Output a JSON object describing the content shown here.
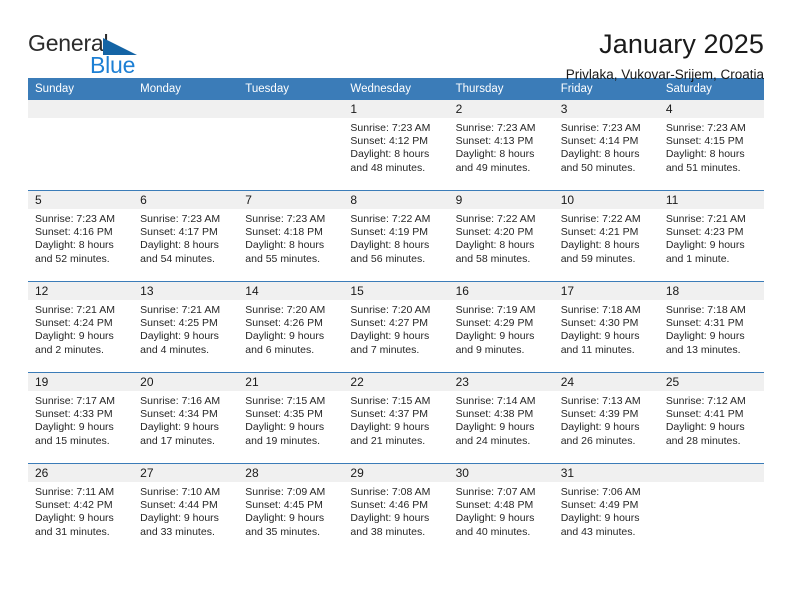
{
  "brand": {
    "name_top": "General",
    "name_bottom": "Blue",
    "triangle_color": "#1464a5",
    "blue_color": "#1c7fd4"
  },
  "header": {
    "title": "January 2025",
    "subtitle": "Privlaka, Vukovar-Srijem, Croatia"
  },
  "theme": {
    "header_blue": "#3b7cb8",
    "daynum_band": "#f0f0f0",
    "text": "#1a1a1a"
  },
  "weekday_headers": [
    "Sunday",
    "Monday",
    "Tuesday",
    "Wednesday",
    "Thursday",
    "Friday",
    "Saturday"
  ],
  "weeks": [
    [
      {
        "day": "",
        "empty": true
      },
      {
        "day": "",
        "empty": true
      },
      {
        "day": "",
        "empty": true
      },
      {
        "day": "1",
        "sunrise": "Sunrise: 7:23 AM",
        "sunset": "Sunset: 4:12 PM",
        "daylight1": "Daylight: 8 hours",
        "daylight2": "and 48 minutes."
      },
      {
        "day": "2",
        "sunrise": "Sunrise: 7:23 AM",
        "sunset": "Sunset: 4:13 PM",
        "daylight1": "Daylight: 8 hours",
        "daylight2": "and 49 minutes."
      },
      {
        "day": "3",
        "sunrise": "Sunrise: 7:23 AM",
        "sunset": "Sunset: 4:14 PM",
        "daylight1": "Daylight: 8 hours",
        "daylight2": "and 50 minutes."
      },
      {
        "day": "4",
        "sunrise": "Sunrise: 7:23 AM",
        "sunset": "Sunset: 4:15 PM",
        "daylight1": "Daylight: 8 hours",
        "daylight2": "and 51 minutes."
      }
    ],
    [
      {
        "day": "5",
        "sunrise": "Sunrise: 7:23 AM",
        "sunset": "Sunset: 4:16 PM",
        "daylight1": "Daylight: 8 hours",
        "daylight2": "and 52 minutes."
      },
      {
        "day": "6",
        "sunrise": "Sunrise: 7:23 AM",
        "sunset": "Sunset: 4:17 PM",
        "daylight1": "Daylight: 8 hours",
        "daylight2": "and 54 minutes."
      },
      {
        "day": "7",
        "sunrise": "Sunrise: 7:23 AM",
        "sunset": "Sunset: 4:18 PM",
        "daylight1": "Daylight: 8 hours",
        "daylight2": "and 55 minutes."
      },
      {
        "day": "8",
        "sunrise": "Sunrise: 7:22 AM",
        "sunset": "Sunset: 4:19 PM",
        "daylight1": "Daylight: 8 hours",
        "daylight2": "and 56 minutes."
      },
      {
        "day": "9",
        "sunrise": "Sunrise: 7:22 AM",
        "sunset": "Sunset: 4:20 PM",
        "daylight1": "Daylight: 8 hours",
        "daylight2": "and 58 minutes."
      },
      {
        "day": "10",
        "sunrise": "Sunrise: 7:22 AM",
        "sunset": "Sunset: 4:21 PM",
        "daylight1": "Daylight: 8 hours",
        "daylight2": "and 59 minutes."
      },
      {
        "day": "11",
        "sunrise": "Sunrise: 7:21 AM",
        "sunset": "Sunset: 4:23 PM",
        "daylight1": "Daylight: 9 hours",
        "daylight2": "and 1 minute."
      }
    ],
    [
      {
        "day": "12",
        "sunrise": "Sunrise: 7:21 AM",
        "sunset": "Sunset: 4:24 PM",
        "daylight1": "Daylight: 9 hours",
        "daylight2": "and 2 minutes."
      },
      {
        "day": "13",
        "sunrise": "Sunrise: 7:21 AM",
        "sunset": "Sunset: 4:25 PM",
        "daylight1": "Daylight: 9 hours",
        "daylight2": "and 4 minutes."
      },
      {
        "day": "14",
        "sunrise": "Sunrise: 7:20 AM",
        "sunset": "Sunset: 4:26 PM",
        "daylight1": "Daylight: 9 hours",
        "daylight2": "and 6 minutes."
      },
      {
        "day": "15",
        "sunrise": "Sunrise: 7:20 AM",
        "sunset": "Sunset: 4:27 PM",
        "daylight1": "Daylight: 9 hours",
        "daylight2": "and 7 minutes."
      },
      {
        "day": "16",
        "sunrise": "Sunrise: 7:19 AM",
        "sunset": "Sunset: 4:29 PM",
        "daylight1": "Daylight: 9 hours",
        "daylight2": "and 9 minutes."
      },
      {
        "day": "17",
        "sunrise": "Sunrise: 7:18 AM",
        "sunset": "Sunset: 4:30 PM",
        "daylight1": "Daylight: 9 hours",
        "daylight2": "and 11 minutes."
      },
      {
        "day": "18",
        "sunrise": "Sunrise: 7:18 AM",
        "sunset": "Sunset: 4:31 PM",
        "daylight1": "Daylight: 9 hours",
        "daylight2": "and 13 minutes."
      }
    ],
    [
      {
        "day": "19",
        "sunrise": "Sunrise: 7:17 AM",
        "sunset": "Sunset: 4:33 PM",
        "daylight1": "Daylight: 9 hours",
        "daylight2": "and 15 minutes."
      },
      {
        "day": "20",
        "sunrise": "Sunrise: 7:16 AM",
        "sunset": "Sunset: 4:34 PM",
        "daylight1": "Daylight: 9 hours",
        "daylight2": "and 17 minutes."
      },
      {
        "day": "21",
        "sunrise": "Sunrise: 7:15 AM",
        "sunset": "Sunset: 4:35 PM",
        "daylight1": "Daylight: 9 hours",
        "daylight2": "and 19 minutes."
      },
      {
        "day": "22",
        "sunrise": "Sunrise: 7:15 AM",
        "sunset": "Sunset: 4:37 PM",
        "daylight1": "Daylight: 9 hours",
        "daylight2": "and 21 minutes."
      },
      {
        "day": "23",
        "sunrise": "Sunrise: 7:14 AM",
        "sunset": "Sunset: 4:38 PM",
        "daylight1": "Daylight: 9 hours",
        "daylight2": "and 24 minutes."
      },
      {
        "day": "24",
        "sunrise": "Sunrise: 7:13 AM",
        "sunset": "Sunset: 4:39 PM",
        "daylight1": "Daylight: 9 hours",
        "daylight2": "and 26 minutes."
      },
      {
        "day": "25",
        "sunrise": "Sunrise: 7:12 AM",
        "sunset": "Sunset: 4:41 PM",
        "daylight1": "Daylight: 9 hours",
        "daylight2": "and 28 minutes."
      }
    ],
    [
      {
        "day": "26",
        "sunrise": "Sunrise: 7:11 AM",
        "sunset": "Sunset: 4:42 PM",
        "daylight1": "Daylight: 9 hours",
        "daylight2": "and 31 minutes."
      },
      {
        "day": "27",
        "sunrise": "Sunrise: 7:10 AM",
        "sunset": "Sunset: 4:44 PM",
        "daylight1": "Daylight: 9 hours",
        "daylight2": "and 33 minutes."
      },
      {
        "day": "28",
        "sunrise": "Sunrise: 7:09 AM",
        "sunset": "Sunset: 4:45 PM",
        "daylight1": "Daylight: 9 hours",
        "daylight2": "and 35 minutes."
      },
      {
        "day": "29",
        "sunrise": "Sunrise: 7:08 AM",
        "sunset": "Sunset: 4:46 PM",
        "daylight1": "Daylight: 9 hours",
        "daylight2": "and 38 minutes."
      },
      {
        "day": "30",
        "sunrise": "Sunrise: 7:07 AM",
        "sunset": "Sunset: 4:48 PM",
        "daylight1": "Daylight: 9 hours",
        "daylight2": "and 40 minutes."
      },
      {
        "day": "31",
        "sunrise": "Sunrise: 7:06 AM",
        "sunset": "Sunset: 4:49 PM",
        "daylight1": "Daylight: 9 hours",
        "daylight2": "and 43 minutes."
      },
      {
        "day": "",
        "empty": true
      }
    ]
  ]
}
